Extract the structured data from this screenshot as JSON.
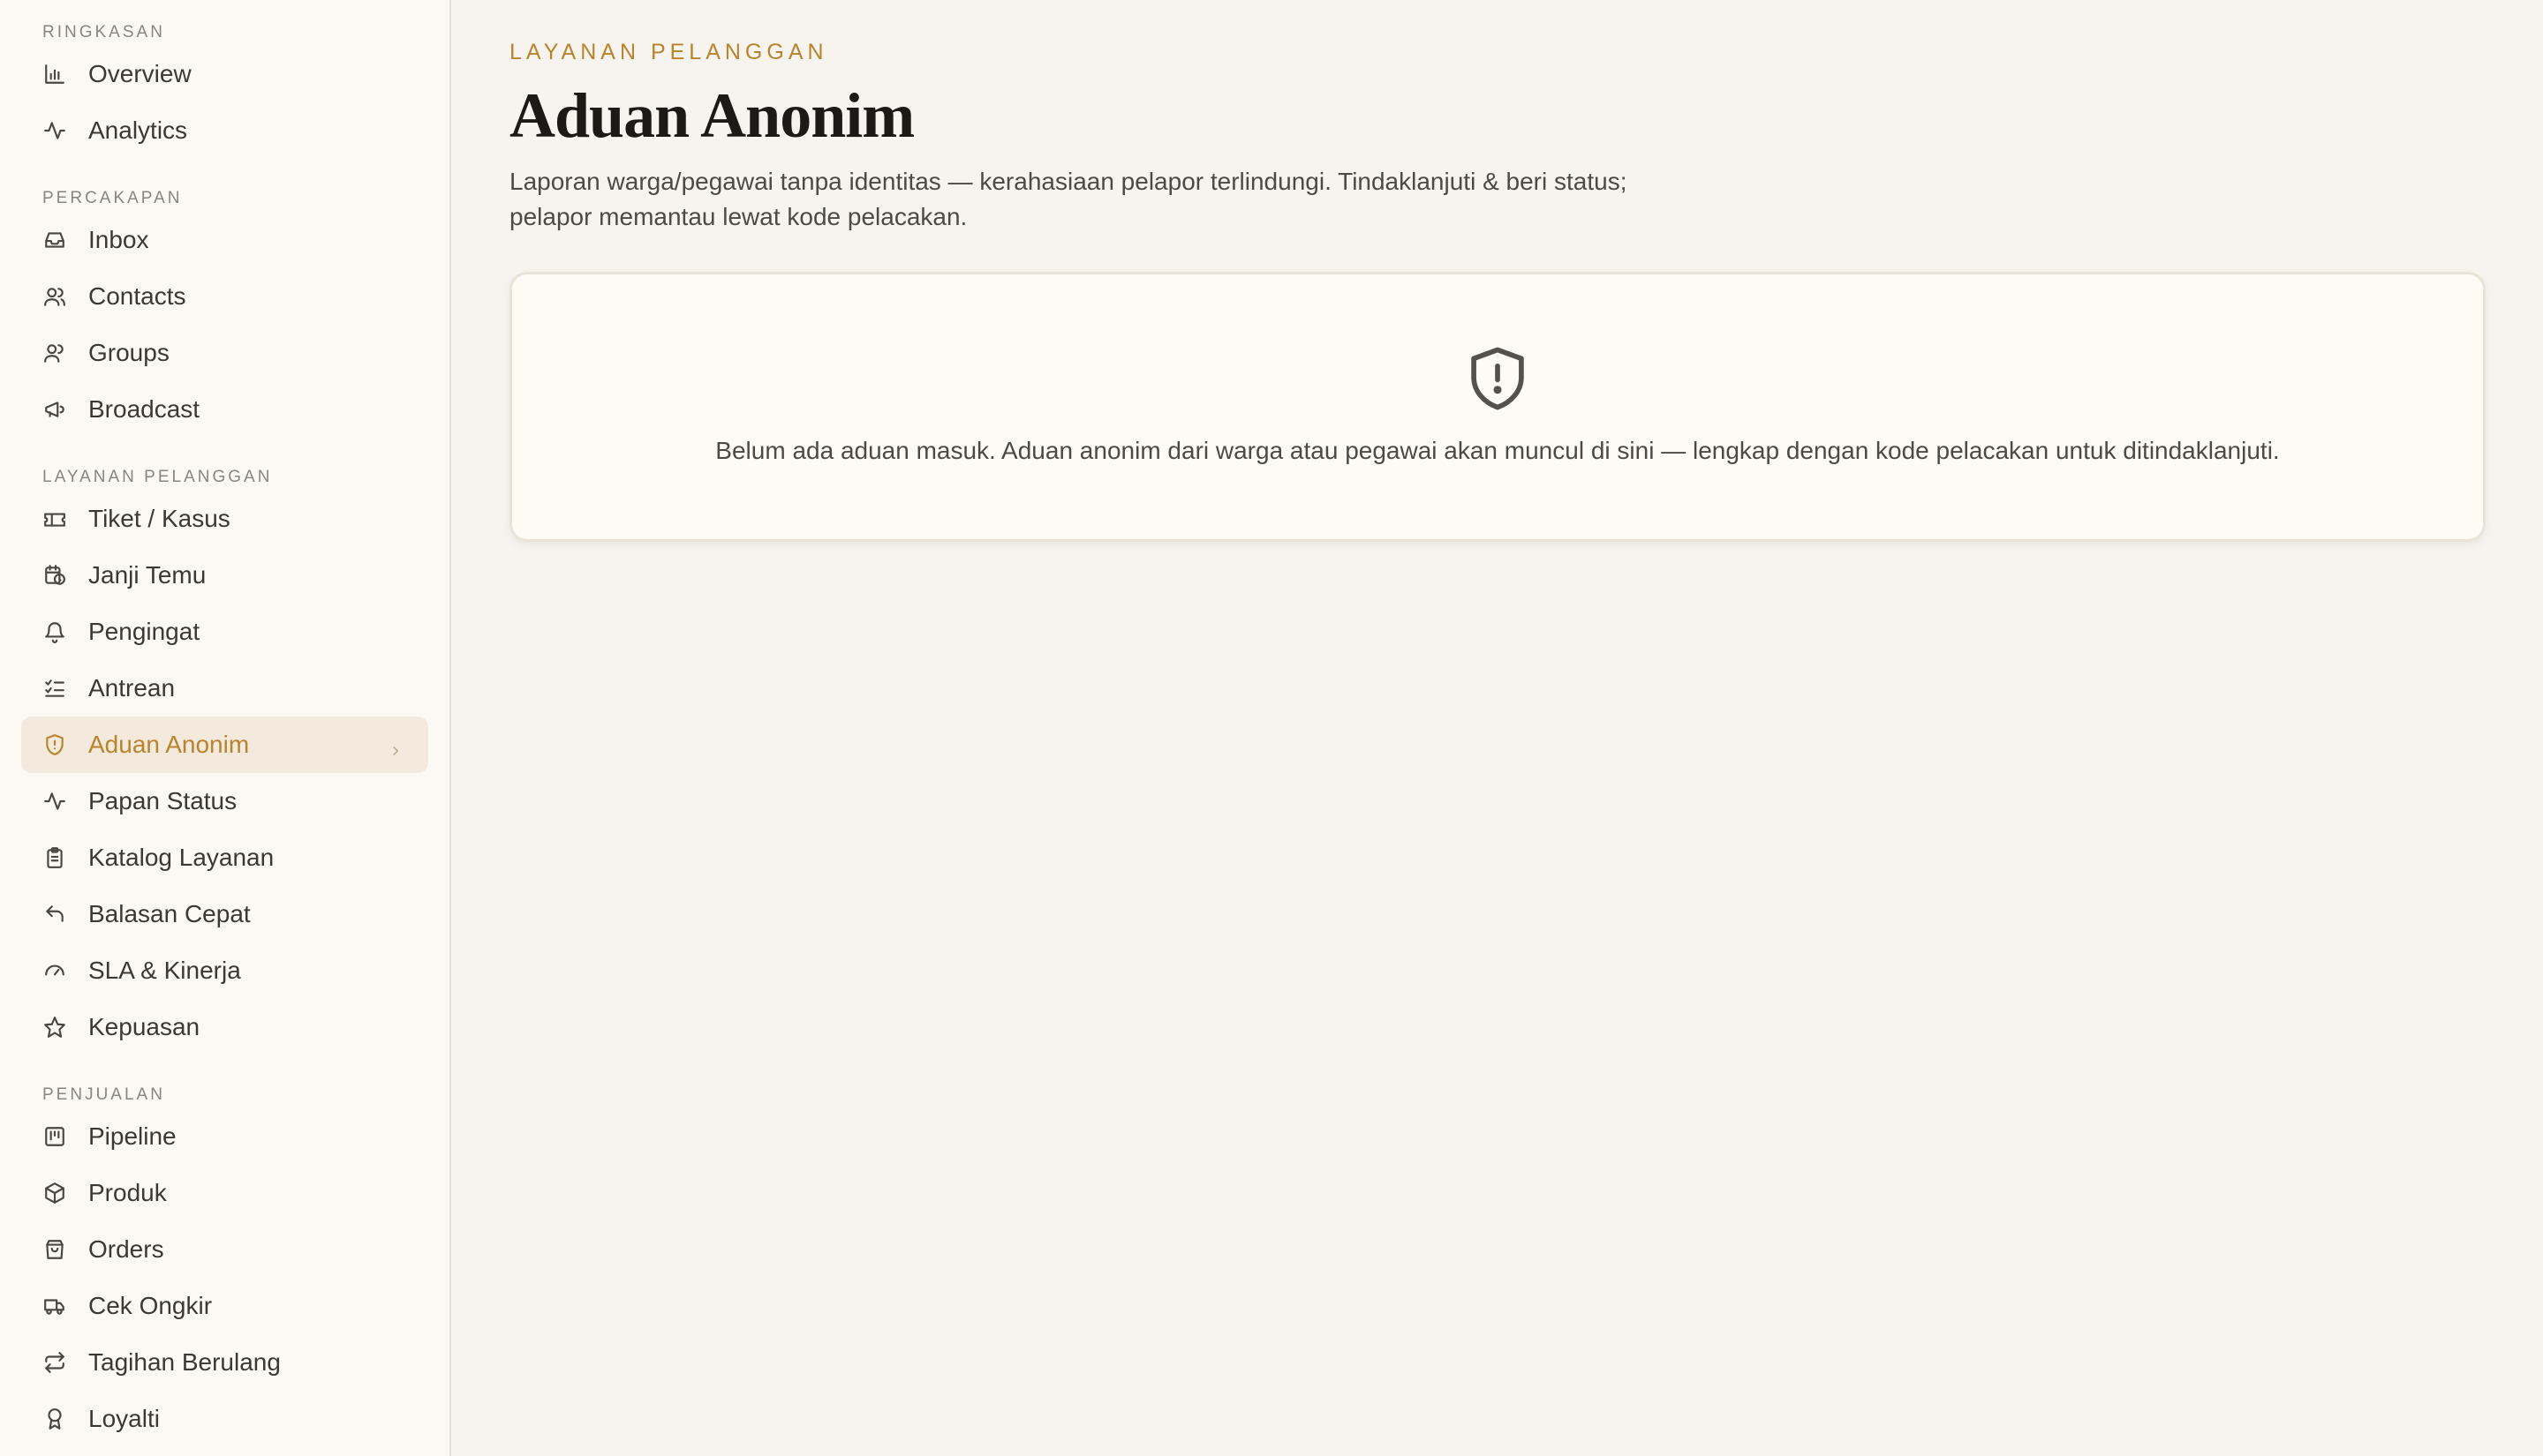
{
  "sidebar": {
    "sections": [
      {
        "label": "RINGKASAN",
        "items": [
          {
            "label": "Overview",
            "icon": "bar-chart-icon"
          },
          {
            "label": "Analytics",
            "icon": "activity-icon"
          }
        ]
      },
      {
        "label": "PERCAKAPAN",
        "items": [
          {
            "label": "Inbox",
            "icon": "inbox-icon"
          },
          {
            "label": "Contacts",
            "icon": "users-icon"
          },
          {
            "label": "Groups",
            "icon": "group-icon"
          },
          {
            "label": "Broadcast",
            "icon": "megaphone-icon"
          }
        ]
      },
      {
        "label": "LAYANAN PELANGGAN",
        "items": [
          {
            "label": "Tiket / Kasus",
            "icon": "ticket-icon"
          },
          {
            "label": "Janji Temu",
            "icon": "calendar-clock-icon"
          },
          {
            "label": "Pengingat",
            "icon": "bell-icon"
          },
          {
            "label": "Antrean",
            "icon": "list-checks-icon"
          },
          {
            "label": "Aduan Anonim",
            "icon": "shield-alert-icon",
            "active": true
          },
          {
            "label": "Papan Status",
            "icon": "activity-icon"
          },
          {
            "label": "Katalog Layanan",
            "icon": "clipboard-icon"
          },
          {
            "label": "Balasan Cepat",
            "icon": "reply-icon"
          },
          {
            "label": "SLA & Kinerja",
            "icon": "gauge-icon"
          },
          {
            "label": "Kepuasan",
            "icon": "star-icon"
          }
        ]
      },
      {
        "label": "PENJUALAN",
        "items": [
          {
            "label": "Pipeline",
            "icon": "kanban-icon"
          },
          {
            "label": "Produk",
            "icon": "package-icon"
          },
          {
            "label": "Orders",
            "icon": "shopping-bag-icon"
          },
          {
            "label": "Cek Ongkir",
            "icon": "truck-icon"
          },
          {
            "label": "Tagihan Berulang",
            "icon": "repeat-icon"
          },
          {
            "label": "Loyalti",
            "icon": "award-icon"
          }
        ]
      }
    ]
  },
  "main": {
    "eyebrow": "LAYANAN PELANGGAN",
    "title": "Aduan Anonim",
    "description": "Laporan warga/pegawai tanpa identitas — kerahasiaan pelapor terlindungi. Tindaklanjuti & beri status; pelapor memantau lewat kode pelacakan.",
    "empty_state": {
      "icon": "shield-alert-icon",
      "message": "Belum ada aduan masuk. Aduan anonim dari warga atau pegawai akan muncul di sini — lengkap dengan kode pelacakan untuk ditindaklanjuti."
    }
  },
  "colors": {
    "accent": "#b8842c",
    "active_bg": "#f3e9dc",
    "page_bg": "#f7f4ef",
    "sidebar_bg": "#fcf9f4"
  }
}
